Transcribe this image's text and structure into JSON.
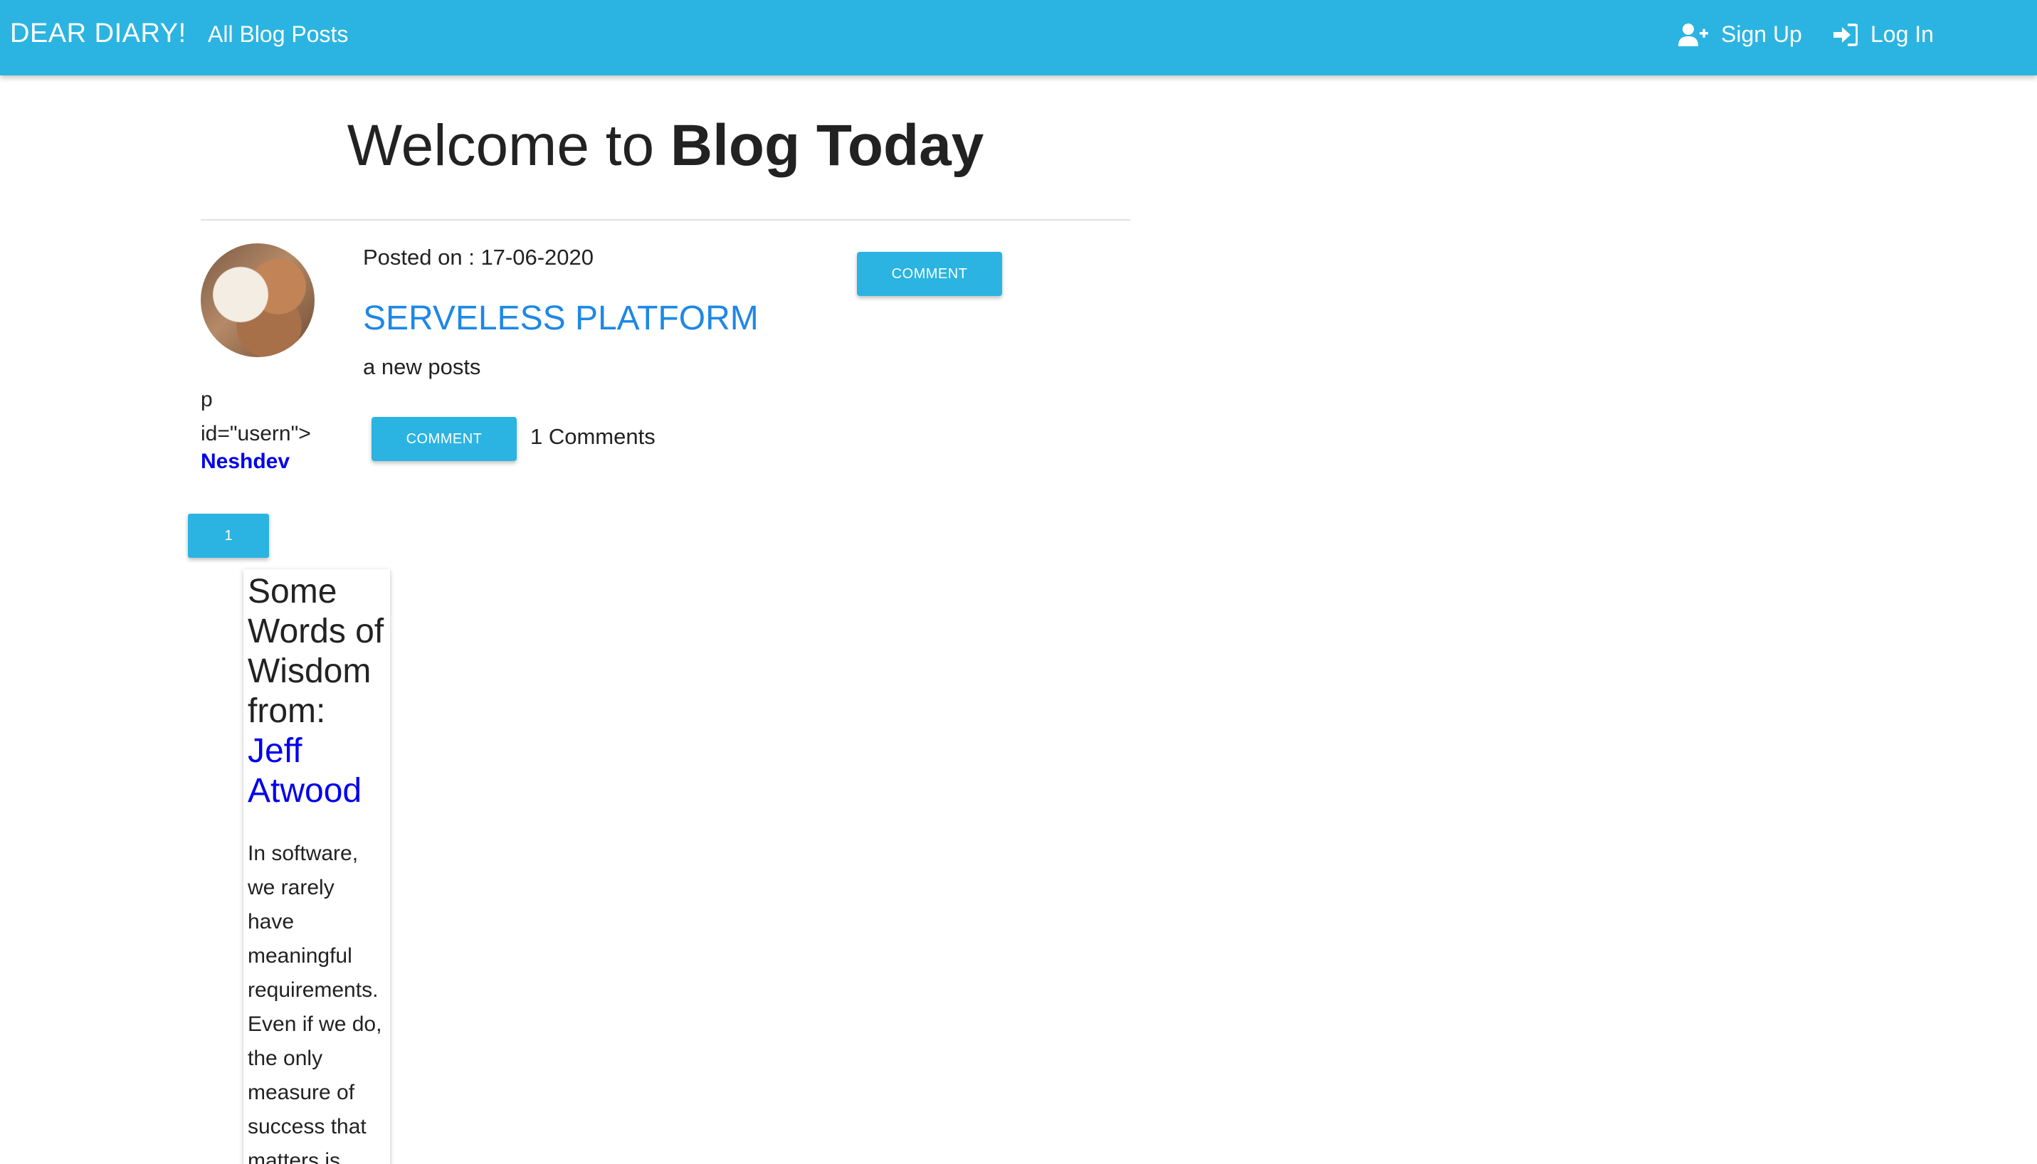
{
  "nav": {
    "brand": "DEAR DIARY!",
    "all_posts": "All Blog Posts",
    "sign_up": "Sign Up",
    "log_in": "Log In",
    "sign_up_icon": "user-plus-icon",
    "log_in_icon": "sign-in-icon"
  },
  "page": {
    "title_light": "Welcome to ",
    "title_bold": "Blog Today"
  },
  "post": {
    "posted_on": "Posted on : 17-06-2020",
    "title": "SERVELESS PLATFORM",
    "body": "a new posts",
    "raw_text": "p\nid=\"usern\">",
    "username": "Neshdev",
    "comment_button_top": "COMMENT",
    "comment_button": "COMMENT",
    "comments_count": "1 Comments"
  },
  "pagination": {
    "current": "1"
  },
  "quote": {
    "heading": "Some Words of Wisdom from:",
    "author": "Jeff Atwood",
    "text": "In software, we rarely have meaningful requirements. Even if we do, the only measure of success that matters is"
  },
  "colors": {
    "primary": "#2bb4e1",
    "link_blue": "#1e88e5",
    "username": "#0000ee"
  }
}
